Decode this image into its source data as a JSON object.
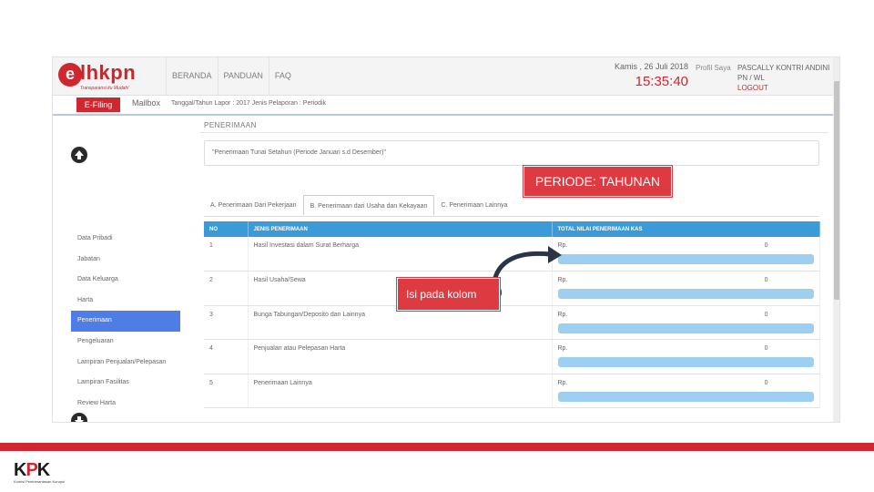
{
  "header": {
    "logo_letter": "e",
    "logo_word": "lhkpn",
    "logo_tagline": "Transparansi itu Mudah!",
    "menu": [
      {
        "label": "BERANDA"
      },
      {
        "label": "PANDUAN"
      },
      {
        "label": "FAQ"
      }
    ],
    "date": "Kamis , 26 Juli 2018",
    "time": "15:35:40",
    "profile_label": "Profil Saya",
    "user_name": "PASCALLY KONTRI ANDINI",
    "user_id": "PN / WL",
    "logout_label": "LOGOUT"
  },
  "subnav": {
    "efiling_label": "E-Filing",
    "mailbox_label": "Mailbox",
    "report_info": "Tanggal/Tahun Lapor : 2017   Jenis Pelaporan : Periodik"
  },
  "sidebar": {
    "items": [
      {
        "label": "Data Pribadi"
      },
      {
        "label": "Jabatan"
      },
      {
        "label": "Data Keluarga"
      },
      {
        "label": "Harta"
      },
      {
        "label": "Penerimaan"
      },
      {
        "label": "Pengeluaran"
      },
      {
        "label": "Lampiran Penjualan/Pelepasan"
      },
      {
        "label": "Lampiran Fasilitas"
      },
      {
        "label": "Review Harta"
      }
    ],
    "active_index": 4
  },
  "main": {
    "section_title": "PENERIMAAN",
    "note": "\"Penerimaan Tunai Setahun (Periode Januari s.d Desember)\"",
    "tabs": [
      {
        "label": "A. Penerimaan Dari Pekerjaan"
      },
      {
        "label": "B. Penerimaan dari Usaha dan Kekayaan"
      },
      {
        "label": "C. Penerimaan Lainnya"
      }
    ],
    "active_tab": 1,
    "table": {
      "headers": [
        "NO",
        "JENIS PENERIMAAN",
        "TOTAL NILAI PENERIMAAN KAS"
      ],
      "currency": "Rp.",
      "rows": [
        {
          "no": "1",
          "jenis": "Hasil Investasi dalam Surat Berharga",
          "nilai": "0"
        },
        {
          "no": "2",
          "jenis": "Hasil Usaha/Sewa",
          "nilai": "0"
        },
        {
          "no": "3",
          "jenis": "Bunga Tabungan/Deposito dan Lainnya",
          "nilai": "0"
        },
        {
          "no": "4",
          "jenis": "Penjualan atau Pelepasan Harta",
          "nilai": "0"
        },
        {
          "no": "5",
          "jenis": "Penerimaan Lainnya",
          "nilai": "0"
        }
      ]
    }
  },
  "callouts": {
    "periode": "PERIODE: TAHUNAN",
    "isi": "Isi pada kolom"
  },
  "footer": {
    "kpk_k1": "K",
    "kpk_p": "P",
    "kpk_k2": "K",
    "kpk_subtitle": "Komisi Pemberantasan Korupsi"
  },
  "colors": {
    "brand_red": "#d0262f",
    "table_header_blue": "#3b9ad8",
    "active_nav_blue": "#4f7de6",
    "input_bar_blue": "#9ccff2"
  }
}
